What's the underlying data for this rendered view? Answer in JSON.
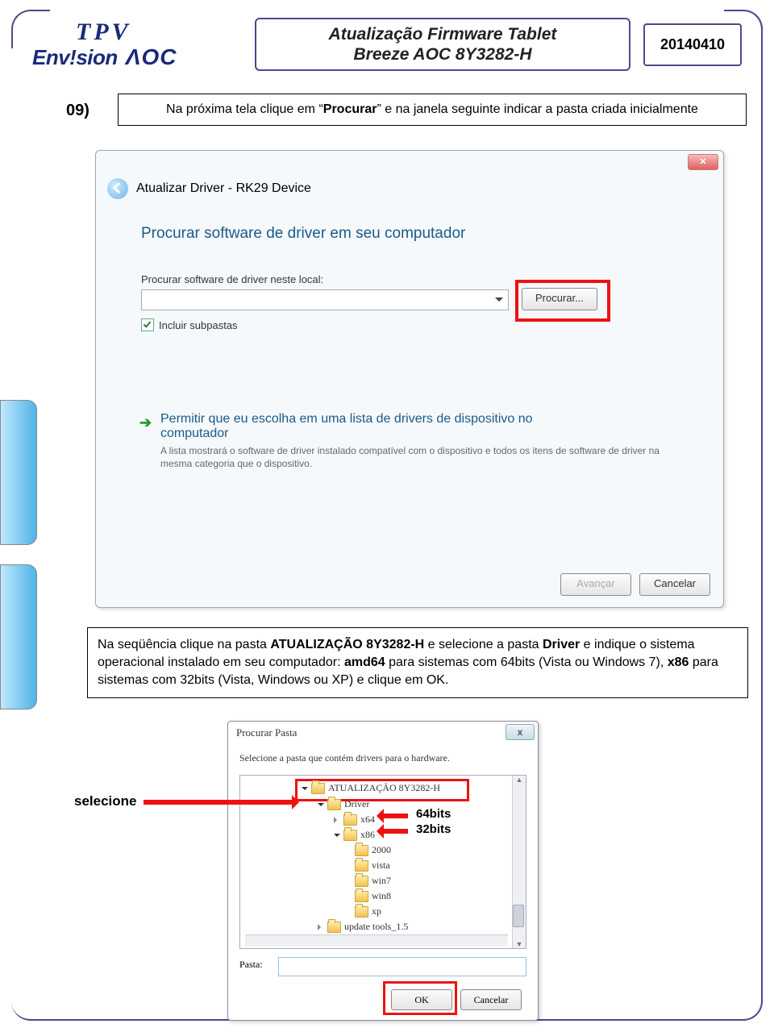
{
  "header": {
    "logo_tpv": "TPV",
    "logo_envision": "Env!sion",
    "logo_aoc": "ΛOC",
    "title_l1": "Atualização Firmware Tablet",
    "title_l2": "Breeze AOC 8Y3282-H",
    "date": "20140410"
  },
  "step": {
    "num": "09)",
    "text_pre": "Na próxima tela clique em “",
    "bold1": "Procurar",
    "text_post": "” e na janela seguinte indicar a pasta criada inicialmente"
  },
  "shot1": {
    "close": "✕",
    "hdr": "Atualizar Driver -  RK29 Device",
    "h1": "Procurar software de driver em seu computador",
    "lbl": "Procurar software de driver neste local:",
    "procurar": "Procurar...",
    "chk": "Incluir subpastas",
    "opt_h1": "Permitir que eu escolha em uma lista de drivers de dispositivo no",
    "opt_h2": "computador",
    "opt_p": "A lista mostrará o software de driver instalado compatível com o dispositivo e todos os itens de software de driver na mesma categoria que o dispositivo.",
    "avancar": "Avançar",
    "cancelar": "Cancelar"
  },
  "inst2": {
    "t1": "Na seqüência clique na pasta ",
    "b1": "ATUALIZAÇÃO 8Y3282-H",
    "t2": " e selecione a pasta ",
    "b2": "Driver",
    "t3": " e indique o sistema operacional instalado em seu computador: ",
    "b3": "amd64",
    "t4": " para sistemas com 64bits (Vista ou Windows 7), ",
    "b4": "x86",
    "t5": " para sistemas com 32bits (Vista, Windows ou XP) e clique em OK."
  },
  "shot2": {
    "title": "Procurar Pasta",
    "x": "x",
    "sub": "Selecione a pasta que contém drivers para o hardware.",
    "nodes": {
      "root": "ATUALIZAÇÃO 8Y3282-H",
      "driver": "Driver",
      "x64": "x64",
      "x86": "x86",
      "n2000": "2000",
      "vista": "vista",
      "win7": "win7",
      "win8": "win8",
      "xp": "xp",
      "upd": "update tools_1.5"
    },
    "pasta_lbl": "Pasta:",
    "ok": "OK",
    "cancel": "Cancelar"
  },
  "ann": {
    "selecione": "selecione",
    "b64": "64bits",
    "b32": "32bits"
  }
}
